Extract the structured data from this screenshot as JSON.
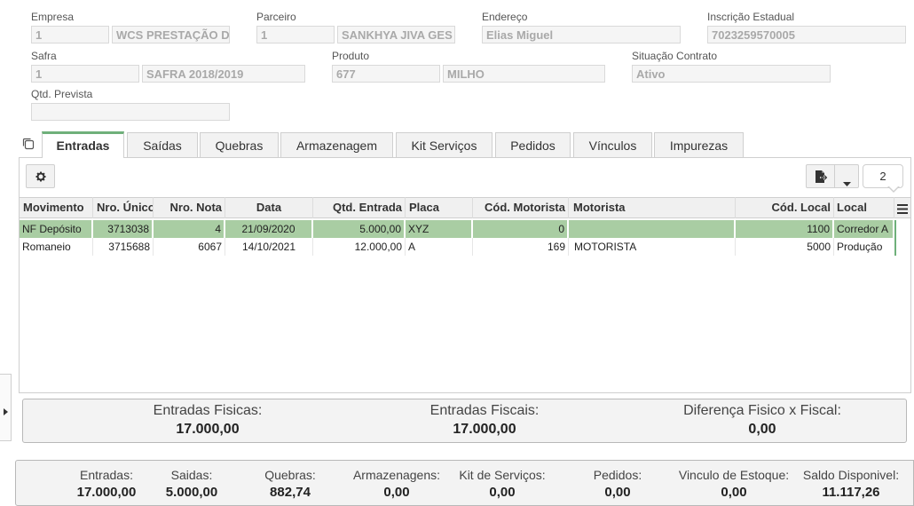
{
  "header_fields": {
    "empresa": {
      "label": "Empresa",
      "code": "1",
      "name": "WCS PRESTAÇÃO D"
    },
    "parceiro": {
      "label": "Parceiro",
      "code": "1",
      "name": "SANKHYA JIVA GES"
    },
    "endereco": {
      "label": "Endereço",
      "value": "Elias Miguel"
    },
    "inscricao": {
      "label": "Inscrição Estadual",
      "value": "7023259570005"
    },
    "safra": {
      "label": "Safra",
      "code": "1",
      "name": "SAFRA 2018/2019"
    },
    "produto": {
      "label": "Produto",
      "code": "677",
      "name": "MILHO"
    },
    "situacao": {
      "label": "Situação Contrato",
      "value": "Ativo"
    },
    "qtd_prevista": {
      "label": "Qtd. Prevista",
      "value": ""
    }
  },
  "tabs": [
    "Entradas",
    "Saídas",
    "Quebras",
    "Armazenagem",
    "Kit Serviços",
    "Pedidos",
    "Vínculos",
    "Impurezas"
  ],
  "toolbar": {
    "record_count": "2"
  },
  "grid": {
    "columns": [
      "Movimento",
      "Nro. Único",
      "Nro. Nota",
      "Data",
      "Qtd. Entrada",
      "Placa",
      "Cód. Motorista",
      "Motorista",
      "Cód. Local",
      "Local"
    ],
    "rows": [
      {
        "movimento": "NF Depósito",
        "nro_unico": "3713038",
        "nro_nota": "4",
        "data": "21/09/2020",
        "qtd": "5.000,00",
        "placa": "XYZ",
        "cod_motorista": "0",
        "motorista": "",
        "cod_local": "1100",
        "local": "Corredor A"
      },
      {
        "movimento": "Romaneio",
        "nro_unico": "3715688",
        "nro_nota": "6067",
        "data": "14/10/2021",
        "qtd": "12.000,00",
        "placa": "A",
        "cod_motorista": "169",
        "motorista": "MOTORISTA",
        "cod_local": "5000",
        "local": "Produção"
      }
    ]
  },
  "inner_summary": [
    {
      "label": "Entradas Fisicas:",
      "value": "17.000,00"
    },
    {
      "label": "Entradas Fiscais:",
      "value": "17.000,00"
    },
    {
      "label": "Diferença Fisico x Fiscal:",
      "value": "0,00"
    }
  ],
  "bottom_summary": [
    {
      "label": "Entradas:",
      "value": "17.000,00"
    },
    {
      "label": "Saidas:",
      "value": "5.000,00"
    },
    {
      "label": "Quebras:",
      "value": "882,74"
    },
    {
      "label": "Armazenagens:",
      "value": "0,00"
    },
    {
      "label": "Kit de Serviços:",
      "value": "0,00"
    },
    {
      "label": "Pedidos:",
      "value": "0,00"
    },
    {
      "label": "Vinculo de Estoque:",
      "value": "0,00"
    },
    {
      "label": "Saldo Disponivel:",
      "value": "11.117,26"
    }
  ]
}
